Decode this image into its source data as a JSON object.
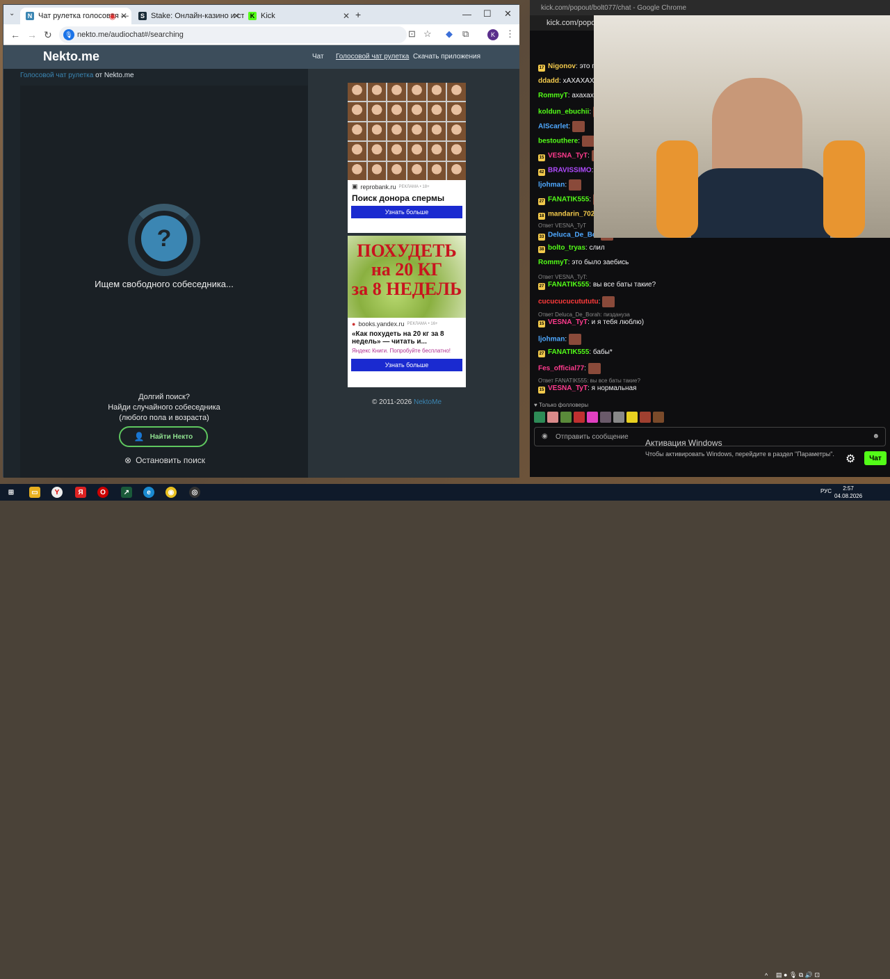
{
  "left_window": {
    "tabs": [
      {
        "label": "Чат рулетка голосовая — "
      },
      {
        "label": "Stake: Онлайн-казино и ставк"
      },
      {
        "label": "Kick"
      }
    ],
    "url": "nekto.me/audiochat#/searching",
    "profile_initial": "K"
  },
  "nekto": {
    "logo": "Nekto.me",
    "nav": [
      "Чат",
      "Голосовой чат рулетка",
      "Скачать приложения"
    ],
    "crumb_link": "Голосовой чат рулетка",
    "crumb_rest": " от Nekto.me",
    "question": "?",
    "searching": "Ищем свободного собеседника...",
    "long_search": "Долгий поиск?",
    "find_random": "Найди случайного собеседника",
    "any_gender": "(любого пола и возраста)",
    "find_button": "Найти Некто",
    "stop_search": "Остановить поиск",
    "footer_year": "© 2011-2026 ",
    "footer_link": "NektoMe"
  },
  "ads": [
    {
      "source": "reprobank.ru",
      "marker": "РЕКЛАМА • 18+",
      "title": "Поиск донора спермы",
      "button": "Узнать больше"
    },
    {
      "image_text": [
        "ПОХУДЕТЬ",
        "на 20 КГ",
        "за 8 НЕДЕЛЬ"
      ],
      "source": "books.yandex.ru",
      "marker": "РЕКЛАМА • 16+",
      "title": "«Как похудеть на 20 кг за 8 недель» — читать и...",
      "promo": "Яндекс Книги. Попробуйте бесплатно!",
      "button": "Узнать больше"
    }
  ],
  "right_window": {
    "title": "kick.com/popout/bolt077/chat - Google Chrome",
    "url": "kick.com/popou"
  },
  "chat": [
    {
      "badge": "17",
      "user": "Nigonov",
      "color": "#f2c94c",
      "text": "это п"
    },
    {
      "user": "ddadd",
      "color": "#f2c94c",
      "text": "хАХАХАХА"
    },
    {
      "user": "RommyT",
      "color": "#53fc18",
      "text": "ахахаха"
    },
    {
      "user": "koldun_ebuchii",
      "color": "#53fc18",
      "text": ""
    },
    {
      "user": "AIScarlet",
      "color": "#4ea8ff",
      "text": ""
    },
    {
      "user": "bestouthere",
      "color": "#53fc18",
      "text": ""
    },
    {
      "badge": "15",
      "user": "VESNA_TyT",
      "color": "#ff3b8e",
      "text": ""
    },
    {
      "badge": "42",
      "user": "BRAVISSIMO",
      "color": "#b04bff",
      "text": ""
    },
    {
      "user": "ljohman",
      "color": "#4ea8ff",
      "text": ""
    },
    {
      "badge": "27",
      "user": "FANATIK555",
      "color": "#53fc18",
      "text": ""
    },
    {
      "badge": "18",
      "user": "mandarin_702",
      "color": "#f2c94c",
      "text": ""
    },
    {
      "reply": "Ответ VESNA_TyT",
      "badge": "33",
      "user": "Deluca_De_Bo",
      "color": "#4ea8ff",
      "text": ""
    },
    {
      "badge": "38",
      "user": "bolto_tryas",
      "color": "#53fc18",
      "text": "слил"
    },
    {
      "user": "RommyT",
      "color": "#53fc18",
      "text": "это было заебись"
    },
    {
      "reply": "Ответ VESNA_TyT:",
      "badge": "27",
      "user": "FANATIK555",
      "color": "#53fc18",
      "text": "вы все баты такие?"
    },
    {
      "user": "cucucucucutututu",
      "color": "#ff3b3b",
      "text": ""
    },
    {
      "reply": "Ответ Deluca_De_Borah: пиздануза",
      "badge": "15",
      "user": "VESNA_TyT",
      "color": "#ff3b8e",
      "text": "и я тебя люблю)"
    },
    {
      "user": "ljohman",
      "color": "#4ea8ff",
      "text": ""
    },
    {
      "badge": "27",
      "user": "FANATIK555",
      "color": "#53fc18",
      "text": "бабы*"
    },
    {
      "user": "Fes_official77",
      "color": "#ff3b8e",
      "text": ""
    },
    {
      "reply": "Ответ FANATIK555: вы все баты такие?",
      "badge": "15",
      "user": "VESNA_TyT",
      "color": "#ff3b8e",
      "text": "я нормальная"
    }
  ],
  "followers_only": "Только фолловеры",
  "send_placeholder": "Отправить сообщение",
  "chat_button": "Чат",
  "windows_activation": {
    "title": "Активация Windows",
    "subtitle": "Чтобы активировать Windows, перейдите в раздел \"Параметры\"."
  },
  "taskbar": {
    "lang": "РУС",
    "time": "2:57",
    "date": "04.08.2026"
  }
}
